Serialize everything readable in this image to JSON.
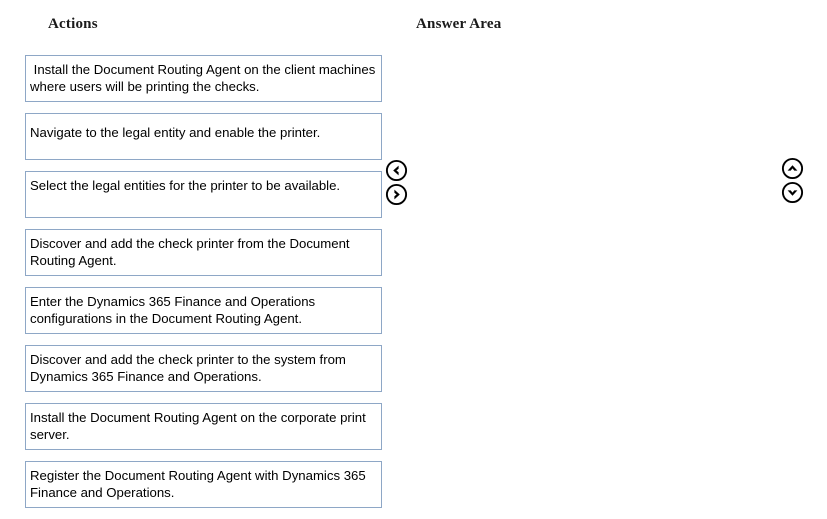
{
  "headers": {
    "actions": "Actions",
    "answer_area": "Answer Area"
  },
  "actions": {
    "items": [
      {
        "id": "install-dra-client-machines",
        "text": " Install the Document Routing Agent on the client machines where users will be printing the checks.",
        "lines": 2
      },
      {
        "id": "navigate-legal-entity-enable-printer",
        "text": "Navigate to the legal entity and enable the printer.",
        "lines": 1
      },
      {
        "id": "select-legal-entities-printer",
        "text": "Select the legal entities for the printer to be available.",
        "lines": 2
      },
      {
        "id": "discover-add-printer-from-dra",
        "text": "Discover and add the check printer from the Document Routing Agent.",
        "lines": 2
      },
      {
        "id": "enter-d365-configurations-in-dra",
        "text": "Enter the Dynamics 365 Finance and Operations configurations in the Document Routing Agent.",
        "lines": 2
      },
      {
        "id": "discover-add-printer-from-d365",
        "text": "Discover and add the check printer to the system from Dynamics 365 Finance and Operations.",
        "lines": 2
      },
      {
        "id": "install-dra-corporate-print-server",
        "text": "Install the Document Routing Agent on the corporate print server.",
        "lines": 2
      },
      {
        "id": "register-dra-with-d365",
        "text": "Register the Document Routing Agent with Dynamics 365 Finance and Operations.",
        "lines": 2
      }
    ]
  },
  "controls": {
    "move_left": {
      "icon": "circled-chevron-left-icon",
      "label": "Move left"
    },
    "move_right": {
      "icon": "circled-chevron-right-icon",
      "label": "Move right"
    },
    "move_up": {
      "icon": "circled-chevron-up-icon",
      "label": "Move up"
    },
    "move_down": {
      "icon": "circled-chevron-down-icon",
      "label": "Move down"
    }
  },
  "colors": {
    "box_border": "#8ea7c6",
    "text": "#000000",
    "background": "#ffffff",
    "icon": "#000000"
  }
}
